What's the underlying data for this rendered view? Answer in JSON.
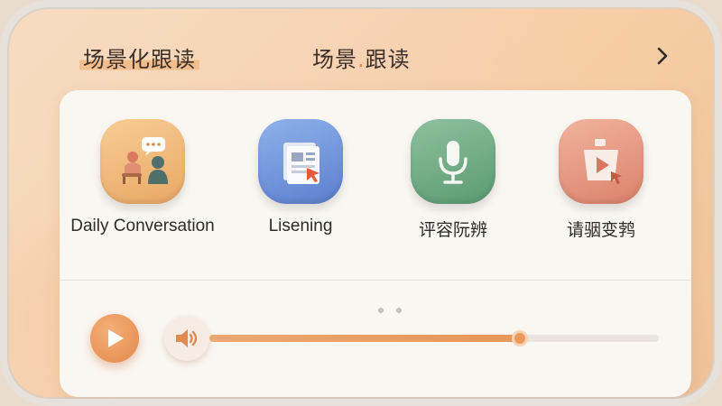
{
  "header": {
    "title_left": "场景化跟读",
    "title_center_a": "场景",
    "title_center_dot": ".",
    "title_center_b": "跟读"
  },
  "modules": [
    {
      "label": "Daily Conversation",
      "icon": "conversation-icon"
    },
    {
      "label": "Lisening",
      "icon": "document-cursor-icon"
    },
    {
      "label": "评容阮辨",
      "icon": "microphone-icon"
    },
    {
      "label": "请骃变鹁",
      "icon": "video-play-icon"
    }
  ],
  "pager": {
    "count": 2
  },
  "player": {
    "progress": 0.69
  },
  "colors": {
    "accent": "#e79656",
    "card": "#faf8f5",
    "background": "#f6d2b2"
  }
}
